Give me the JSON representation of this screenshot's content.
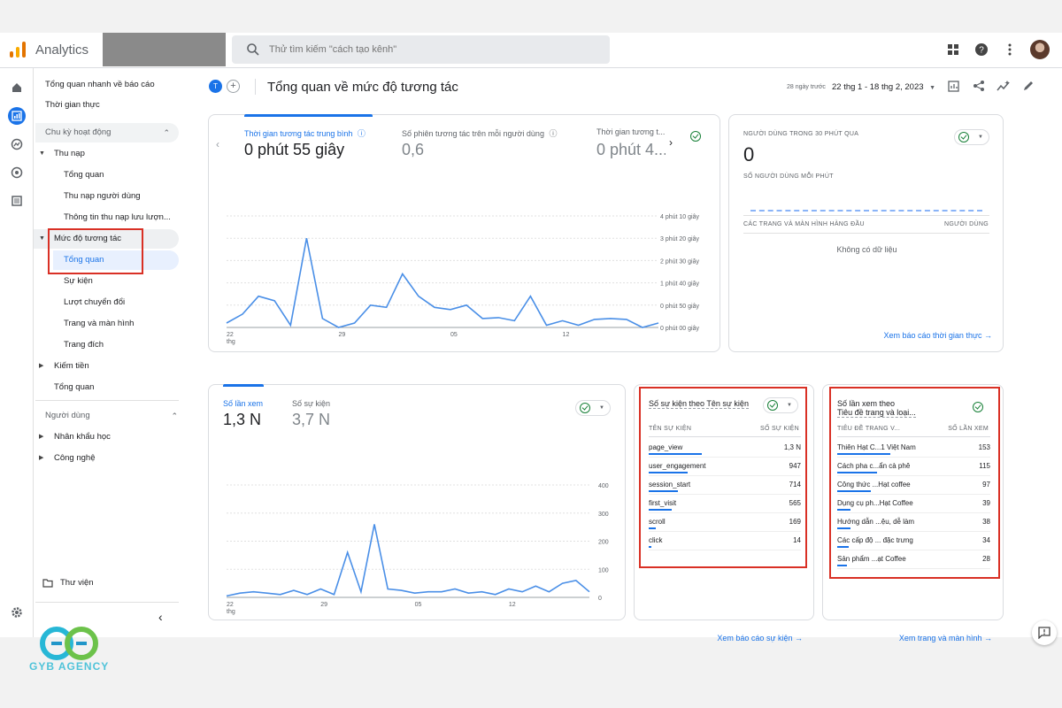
{
  "app": {
    "name": "Analytics"
  },
  "search": {
    "placeholder": "Thử tìm kiếm \"cách tạo kênh\""
  },
  "sidebar": {
    "items": [
      {
        "label": "Tổng quan nhanh về báo cáo"
      },
      {
        "label": "Thời gian thực"
      }
    ],
    "lifecycle": {
      "section": "Chu kỳ hoạt động",
      "acquisition": {
        "label": "Thu nạp",
        "children": [
          "Tổng quan",
          "Thu nạp người dùng",
          "Thông tin thu nạp lưu lượn..."
        ]
      },
      "engagement": {
        "label": "Mức độ tương tác",
        "children": [
          "Tổng quan",
          "Sự kiện",
          "Lượt chuyển đổi",
          "Trang và màn hình",
          "Trang đích"
        ]
      },
      "monetization": {
        "label": "Kiếm tiền"
      },
      "overview": {
        "label": "Tổng quan"
      }
    },
    "user": {
      "section": "Người dùng",
      "demographics": "Nhân khẩu học",
      "tech": "Công nghệ"
    },
    "library": "Thư viện"
  },
  "header": {
    "property_initial": "T",
    "title": "Tổng quan về mức độ tương tác",
    "date_prefix": "28 ngày trước",
    "date_range": "22 thg 1 - 18 thg 2, 2023"
  },
  "engagement_card": {
    "metrics": [
      {
        "label": "Thời gian tương tác trung bình",
        "value": "0 phút 55 giây"
      },
      {
        "label": "Số phiên tương tác trên mỗi người dùng",
        "value": "0,6"
      },
      {
        "label": "Thời gian tương t...",
        "value": "0 phút 4..."
      }
    ],
    "y_ticks": [
      "4 phút 10 giây",
      "3 phút 20 giây",
      "2 phút 30 giây",
      "1 phút 40 giây",
      "0 phút 50 giây",
      "0 phút 00 giây"
    ],
    "x_ticks": [
      "22",
      "29",
      "05",
      "12"
    ],
    "x_sub": "thg"
  },
  "realtime_card": {
    "title": "NGƯỜI DÙNG TRONG 30 PHÚT QUA",
    "value": "0",
    "per_minute": "SỐ NGƯỜI DÙNG MỖI PHÚT",
    "col_pages": "CÁC TRANG VÀ MÀN HÌNH HÀNG ĐẦU",
    "col_users": "NGƯỜI DÙNG",
    "no_data": "Không có dữ liệu",
    "link": "Xem báo cáo thời gian thực"
  },
  "views_card": {
    "metrics": [
      {
        "label": "Số lần xem",
        "value": "1,3 N"
      },
      {
        "label": "Số sự kiện",
        "value": "3,7 N"
      }
    ],
    "y_ticks": [
      "400",
      "300",
      "200",
      "100",
      "0"
    ],
    "x_ticks": [
      "22",
      "29",
      "05",
      "12"
    ],
    "x_sub": "thg"
  },
  "events_card": {
    "title": "Số sự kiện theo Tên sự kiện",
    "col_name": "TÊN SỰ KIỆN",
    "col_value": "SỐ SỰ KIỆN",
    "rows": [
      {
        "name": "page_view",
        "value": "1,3 N",
        "share": 1.0
      },
      {
        "name": "user_engagement",
        "value": "947",
        "share": 0.73
      },
      {
        "name": "session_start",
        "value": "714",
        "share": 0.55
      },
      {
        "name": "first_visit",
        "value": "565",
        "share": 0.43
      },
      {
        "name": "scroll",
        "value": "169",
        "share": 0.13
      },
      {
        "name": "click",
        "value": "14",
        "share": 0.01
      }
    ],
    "link": "Xem báo cáo sự kiện"
  },
  "pages_card": {
    "title_line1": "Số lần xem theo",
    "title_line2": "Tiêu đề trang và loại...",
    "col_name": "TIÊU ĐỀ TRANG V...",
    "col_value": "SỐ LẦN XEM",
    "rows": [
      {
        "name": "Thiên Hạt C...1 Việt Nam",
        "value": "153",
        "share": 1.0
      },
      {
        "name": "Cách pha c...ẩn cà phê",
        "value": "115",
        "share": 0.75
      },
      {
        "name": "Công thức ...Hạt coffee",
        "value": "97",
        "share": 0.63
      },
      {
        "name": "Dụng cụ ph...Hạt Coffee",
        "value": "39",
        "share": 0.25
      },
      {
        "name": "Hướng dẫn ...ệu, dễ làm",
        "value": "38",
        "share": 0.25
      },
      {
        "name": "Các cấp độ ... đặc trưng",
        "value": "34",
        "share": 0.22
      },
      {
        "name": "Sản phẩm ...ạt Coffee",
        "value": "28",
        "share": 0.18
      }
    ],
    "link": "Xem trang và màn hình"
  },
  "chart_data": [
    {
      "type": "line",
      "ylabel": "",
      "xlabel": "",
      "x": [
        "22 thg 1",
        "23",
        "24",
        "25",
        "26",
        "27",
        "28",
        "29",
        "30",
        "31",
        "01",
        "02",
        "03",
        "04",
        "05",
        "06",
        "07",
        "08",
        "09",
        "10",
        "11",
        "12",
        "13",
        "14",
        "15",
        "16",
        "17",
        "18"
      ],
      "series": [
        {
          "values": [
            10,
            30,
            70,
            60,
            5,
            200,
            20,
            0,
            10,
            50,
            45,
            120,
            70,
            45,
            40,
            50,
            20,
            22,
            15,
            70,
            5,
            15,
            5,
            18,
            20,
            18,
            0,
            10
          ]
        }
      ],
      "ylim": [
        0,
        250
      ],
      "y_tick_labels": [
        "0 phút 00 giây",
        "0 phút 50 giây",
        "1 phút 40 giây",
        "2 phút 30 giây",
        "3 phút 20 giây",
        "4 phút 10 giây"
      ]
    },
    {
      "type": "line",
      "ylabel": "",
      "xlabel": "",
      "x": [
        "22 thg 1",
        "23",
        "24",
        "25",
        "26",
        "27",
        "28",
        "29",
        "30",
        "31",
        "01",
        "02",
        "03",
        "04",
        "05",
        "06",
        "07",
        "08",
        "09",
        "10",
        "11",
        "12",
        "13",
        "14",
        "15",
        "16",
        "17",
        "18"
      ],
      "series": [
        {
          "name": "Số lần xem",
          "values": [
            5,
            15,
            20,
            15,
            10,
            25,
            10,
            30,
            10,
            160,
            20,
            260,
            30,
            25,
            15,
            20,
            20,
            30,
            15,
            20,
            10,
            30,
            20,
            40,
            20,
            50,
            60,
            20
          ]
        }
      ],
      "ylim": [
        0,
        400
      ]
    }
  ],
  "colors": {
    "accent": "#1a73e8",
    "highlight": "#d93025",
    "ok": "#188038"
  }
}
